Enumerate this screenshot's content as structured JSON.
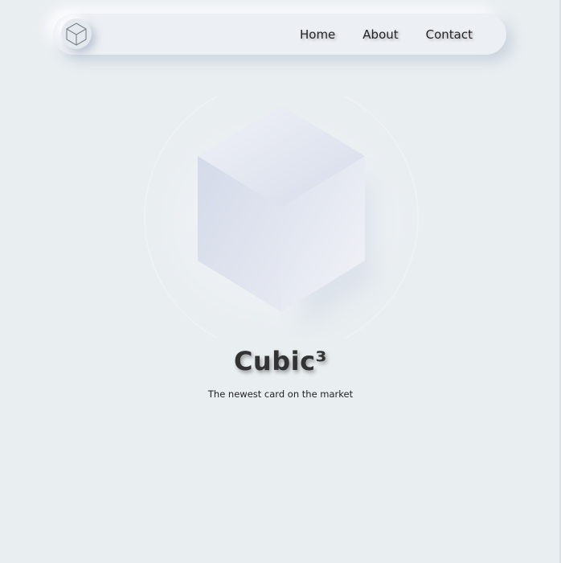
{
  "nav": {
    "logo": {
      "icon": "cube-icon"
    },
    "links": [
      {
        "label": "Home"
      },
      {
        "label": "About"
      },
      {
        "label": "Contact"
      }
    ]
  },
  "hero": {
    "graphic": {
      "icon": "cube-icon"
    },
    "title": "Cubic³",
    "subtitle": "The newest card on the market"
  },
  "colors": {
    "background": "#e9eef1",
    "nav_surface": "#eceff3",
    "text": "#222222",
    "cube_light": "#eef1f6",
    "cube_mid": "#dfe4ef",
    "cube_dark": "#cbd3e4"
  }
}
